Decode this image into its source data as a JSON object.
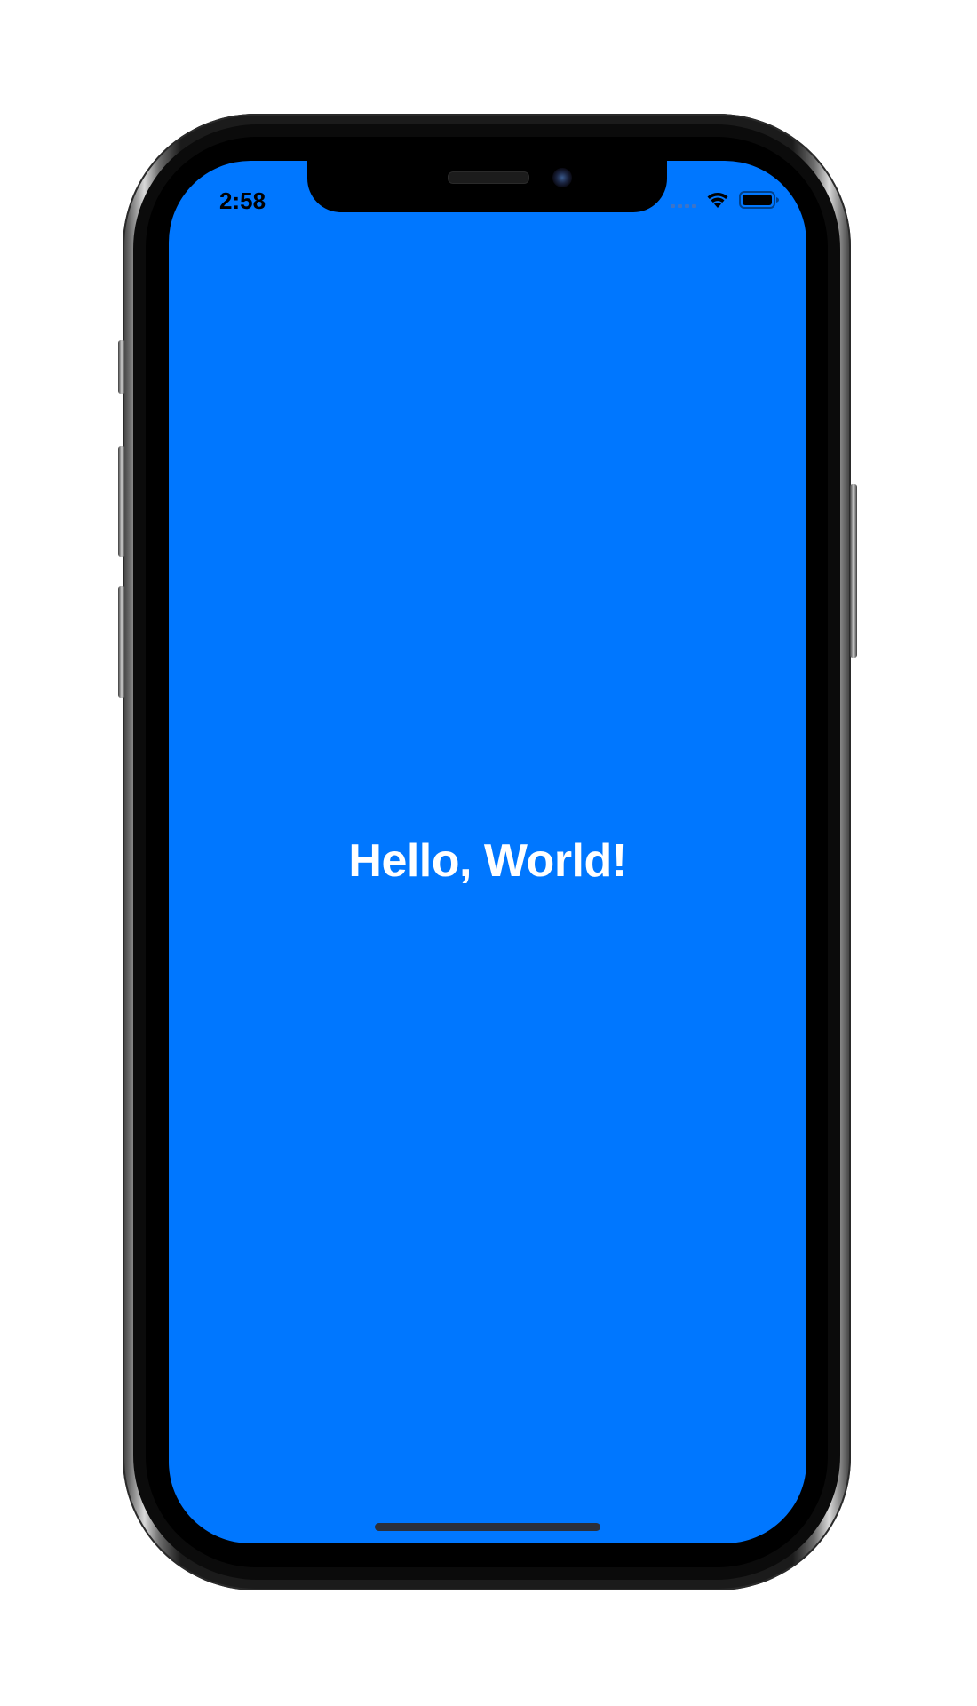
{
  "status_bar": {
    "time": "2:58",
    "wifi_icon": "wifi-icon",
    "battery_icon": "battery-icon",
    "signal_icon": "cellular-signal-icon"
  },
  "main": {
    "headline": "Hello, World!"
  },
  "colors": {
    "screen_background": "#0077FF",
    "headline_text": "#ffffff",
    "status_text": "#000000"
  }
}
